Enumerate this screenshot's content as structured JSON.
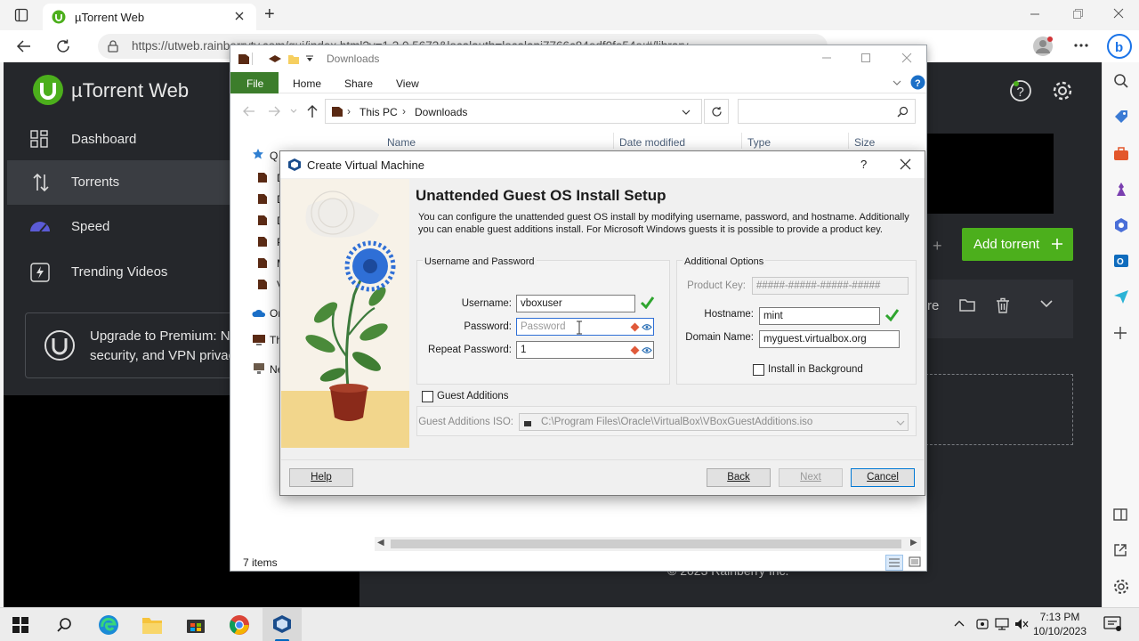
{
  "browser": {
    "tab_title": "µTorrent Web",
    "url": "https://utweb.rainberrytv.com/gui/index.html?v=1.3.0.5673&localauth=localapi7766c84edf0fe54e:#/library",
    "new_tab_symbol": "+"
  },
  "utorrent": {
    "logo_text": "µTorrent Web",
    "nav": [
      {
        "label": "Dashboard"
      },
      {
        "label": "Torrents"
      },
      {
        "label": "Speed"
      },
      {
        "label": "Trending Videos"
      }
    ],
    "upgrade_line1": "Upgrade to Premium: N",
    "upgrade_line2": "security, and VPN privac",
    "add_torrent_label": "Add torrent",
    "toolbar_partial": "re",
    "copyright": "© 2023 Rainberry Inc."
  },
  "explorer": {
    "title": "Downloads",
    "ribbon": {
      "file": "File",
      "home": "Home",
      "share": "Share",
      "view": "View"
    },
    "breadcrumb": [
      "This PC",
      "Downloads"
    ],
    "columns": [
      "Name",
      "Date modified",
      "Type",
      "Size"
    ],
    "nav_items": [
      "Q",
      "D",
      "D",
      "D",
      "P",
      "M",
      "V",
      "Or",
      "Th",
      "Ne"
    ],
    "status": "7 items"
  },
  "vbox": {
    "title": "Create Virtual Machine",
    "heading": "Unattended Guest OS Install Setup",
    "description": "You can configure the unattended guest OS install by modifying username, password, and hostname. Additionally you can enable guest additions install. For Microsoft Windows guests it is possible to provide a product key.",
    "user_group": "Username and Password",
    "username_label": "Username:",
    "username_value": "vboxuser",
    "password_label": "Password:",
    "password_placeholder": "Password",
    "repeat_label": "Repeat Password:",
    "repeat_value": "1",
    "additional_group": "Additional Options",
    "product_key_label": "Product Key:",
    "product_key_value": "#####-#####-#####-#####",
    "hostname_label": "Hostname:",
    "hostname_value": "mint",
    "domain_label": "Domain Name:",
    "domain_value": "myguest.virtualbox.org",
    "install_bg_label": "Install in Background",
    "guest_additions_label": "Guest Additions",
    "guest_iso_label": "Guest Additions ISO:",
    "guest_iso_value": "C:\\Program Files\\Oracle\\VirtualBox\\VBoxGuestAdditions.iso",
    "help_label": "Help",
    "back_label": "Back",
    "next_label": "Next",
    "cancel_label": "Cancel",
    "help_symbol": "?"
  },
  "taskbar": {
    "time": "7:13 PM",
    "date": "10/10/2023"
  },
  "colors": {
    "utorrent_green": "#4caf1c",
    "explorer_file_tab": "#3c7d2b",
    "vbox_valid_check": "#2fa52f"
  }
}
